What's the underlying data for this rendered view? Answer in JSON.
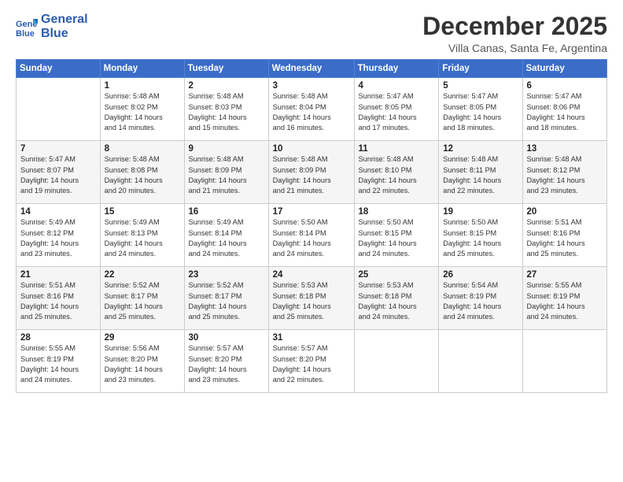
{
  "logo": {
    "line1": "General",
    "line2": "Blue"
  },
  "title": "December 2025",
  "subtitle": "Villa Canas, Santa Fe, Argentina",
  "header_days": [
    "Sunday",
    "Monday",
    "Tuesday",
    "Wednesday",
    "Thursday",
    "Friday",
    "Saturday"
  ],
  "weeks": [
    [
      {
        "day": "",
        "info": ""
      },
      {
        "day": "1",
        "info": "Sunrise: 5:48 AM\nSunset: 8:02 PM\nDaylight: 14 hours\nand 14 minutes."
      },
      {
        "day": "2",
        "info": "Sunrise: 5:48 AM\nSunset: 8:03 PM\nDaylight: 14 hours\nand 15 minutes."
      },
      {
        "day": "3",
        "info": "Sunrise: 5:48 AM\nSunset: 8:04 PM\nDaylight: 14 hours\nand 16 minutes."
      },
      {
        "day": "4",
        "info": "Sunrise: 5:47 AM\nSunset: 8:05 PM\nDaylight: 14 hours\nand 17 minutes."
      },
      {
        "day": "5",
        "info": "Sunrise: 5:47 AM\nSunset: 8:05 PM\nDaylight: 14 hours\nand 18 minutes."
      },
      {
        "day": "6",
        "info": "Sunrise: 5:47 AM\nSunset: 8:06 PM\nDaylight: 14 hours\nand 18 minutes."
      }
    ],
    [
      {
        "day": "7",
        "info": "Sunrise: 5:47 AM\nSunset: 8:07 PM\nDaylight: 14 hours\nand 19 minutes."
      },
      {
        "day": "8",
        "info": "Sunrise: 5:48 AM\nSunset: 8:08 PM\nDaylight: 14 hours\nand 20 minutes."
      },
      {
        "day": "9",
        "info": "Sunrise: 5:48 AM\nSunset: 8:09 PM\nDaylight: 14 hours\nand 21 minutes."
      },
      {
        "day": "10",
        "info": "Sunrise: 5:48 AM\nSunset: 8:09 PM\nDaylight: 14 hours\nand 21 minutes."
      },
      {
        "day": "11",
        "info": "Sunrise: 5:48 AM\nSunset: 8:10 PM\nDaylight: 14 hours\nand 22 minutes."
      },
      {
        "day": "12",
        "info": "Sunrise: 5:48 AM\nSunset: 8:11 PM\nDaylight: 14 hours\nand 22 minutes."
      },
      {
        "day": "13",
        "info": "Sunrise: 5:48 AM\nSunset: 8:12 PM\nDaylight: 14 hours\nand 23 minutes."
      }
    ],
    [
      {
        "day": "14",
        "info": "Sunrise: 5:49 AM\nSunset: 8:12 PM\nDaylight: 14 hours\nand 23 minutes."
      },
      {
        "day": "15",
        "info": "Sunrise: 5:49 AM\nSunset: 8:13 PM\nDaylight: 14 hours\nand 24 minutes."
      },
      {
        "day": "16",
        "info": "Sunrise: 5:49 AM\nSunset: 8:14 PM\nDaylight: 14 hours\nand 24 minutes."
      },
      {
        "day": "17",
        "info": "Sunrise: 5:50 AM\nSunset: 8:14 PM\nDaylight: 14 hours\nand 24 minutes."
      },
      {
        "day": "18",
        "info": "Sunrise: 5:50 AM\nSunset: 8:15 PM\nDaylight: 14 hours\nand 24 minutes."
      },
      {
        "day": "19",
        "info": "Sunrise: 5:50 AM\nSunset: 8:15 PM\nDaylight: 14 hours\nand 25 minutes."
      },
      {
        "day": "20",
        "info": "Sunrise: 5:51 AM\nSunset: 8:16 PM\nDaylight: 14 hours\nand 25 minutes."
      }
    ],
    [
      {
        "day": "21",
        "info": "Sunrise: 5:51 AM\nSunset: 8:16 PM\nDaylight: 14 hours\nand 25 minutes."
      },
      {
        "day": "22",
        "info": "Sunrise: 5:52 AM\nSunset: 8:17 PM\nDaylight: 14 hours\nand 25 minutes."
      },
      {
        "day": "23",
        "info": "Sunrise: 5:52 AM\nSunset: 8:17 PM\nDaylight: 14 hours\nand 25 minutes."
      },
      {
        "day": "24",
        "info": "Sunrise: 5:53 AM\nSunset: 8:18 PM\nDaylight: 14 hours\nand 25 minutes."
      },
      {
        "day": "25",
        "info": "Sunrise: 5:53 AM\nSunset: 8:18 PM\nDaylight: 14 hours\nand 24 minutes."
      },
      {
        "day": "26",
        "info": "Sunrise: 5:54 AM\nSunset: 8:19 PM\nDaylight: 14 hours\nand 24 minutes."
      },
      {
        "day": "27",
        "info": "Sunrise: 5:55 AM\nSunset: 8:19 PM\nDaylight: 14 hours\nand 24 minutes."
      }
    ],
    [
      {
        "day": "28",
        "info": "Sunrise: 5:55 AM\nSunset: 8:19 PM\nDaylight: 14 hours\nand 24 minutes."
      },
      {
        "day": "29",
        "info": "Sunrise: 5:56 AM\nSunset: 8:20 PM\nDaylight: 14 hours\nand 23 minutes."
      },
      {
        "day": "30",
        "info": "Sunrise: 5:57 AM\nSunset: 8:20 PM\nDaylight: 14 hours\nand 23 minutes."
      },
      {
        "day": "31",
        "info": "Sunrise: 5:57 AM\nSunset: 8:20 PM\nDaylight: 14 hours\nand 22 minutes."
      },
      {
        "day": "",
        "info": ""
      },
      {
        "day": "",
        "info": ""
      },
      {
        "day": "",
        "info": ""
      }
    ]
  ]
}
